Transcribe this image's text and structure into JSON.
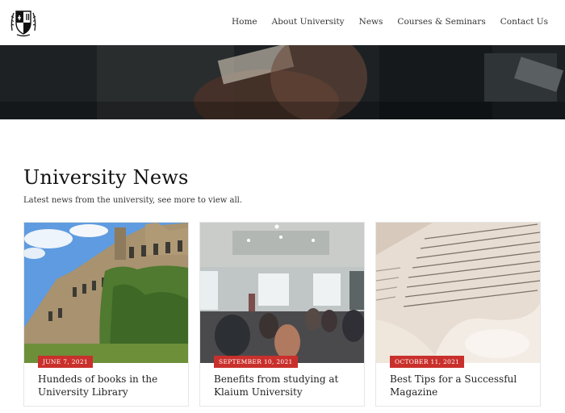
{
  "nav": {
    "items": [
      "Home",
      "About University",
      "News",
      "Courses & Seminars",
      "Contact Us"
    ]
  },
  "section": {
    "title": "University News",
    "subtitle": "Latest news from the university, see more to view all."
  },
  "cards": [
    {
      "date": "JUNE 7, 2021",
      "title": "Hundeds of books in the University Library"
    },
    {
      "date": "SEPTEMBER 10, 2021",
      "title": "Benefits from studying at Klaium University"
    },
    {
      "date": "OCTOBER 11, 2021",
      "title": "Best Tips for a Successful Magazine"
    }
  ],
  "colors": {
    "accent": "#c9302c"
  }
}
